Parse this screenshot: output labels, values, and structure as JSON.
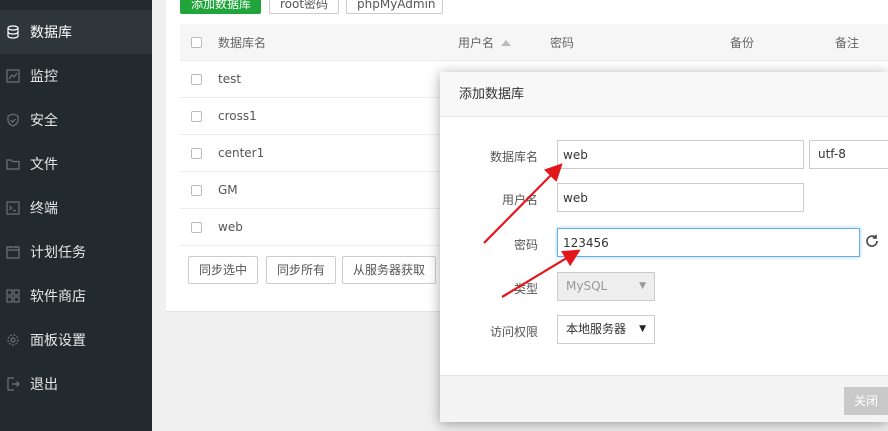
{
  "sidebar": {
    "items": [
      {
        "label": "数据库",
        "icon": "database-icon",
        "active": true
      },
      {
        "label": "监控",
        "icon": "monitor-icon"
      },
      {
        "label": "安全",
        "icon": "shield-icon"
      },
      {
        "label": "文件",
        "icon": "folder-icon"
      },
      {
        "label": "终端",
        "icon": "terminal-icon"
      },
      {
        "label": "计划任务",
        "icon": "calendar-icon"
      },
      {
        "label": "软件商店",
        "icon": "grid-icon"
      },
      {
        "label": "面板设置",
        "icon": "gear-icon"
      },
      {
        "label": "退出",
        "icon": "logout-icon"
      }
    ]
  },
  "toolbar": {
    "add_db": "添加数据库",
    "root_pwd": "root密码",
    "phpmyadmin": "phpMyAdmin"
  },
  "table": {
    "headers": {
      "name": "数据库名",
      "user": "用户名",
      "password": "密码",
      "backup": "备份",
      "note": "备注"
    },
    "rows": [
      "test",
      "cross1",
      "center1",
      "GM",
      "web"
    ]
  },
  "actions": {
    "sync_selected": "同步选中",
    "sync_all": "同步所有",
    "fetch_server": "从服务器获取"
  },
  "modal": {
    "title": "添加数据库",
    "labels": {
      "dbname": "数据库名",
      "username": "用户名",
      "password": "密码",
      "type": "类型",
      "access": "访问权限"
    },
    "values": {
      "dbname": "web",
      "charset": "utf-8",
      "username": "web",
      "password": "123456",
      "type": "MySQL",
      "access": "本地服务器"
    },
    "close_label": "关闭"
  },
  "colors": {
    "sidebar_bg": "#222a2e",
    "accent_green": "#20a53a",
    "arrow_red": "#e3161c"
  }
}
